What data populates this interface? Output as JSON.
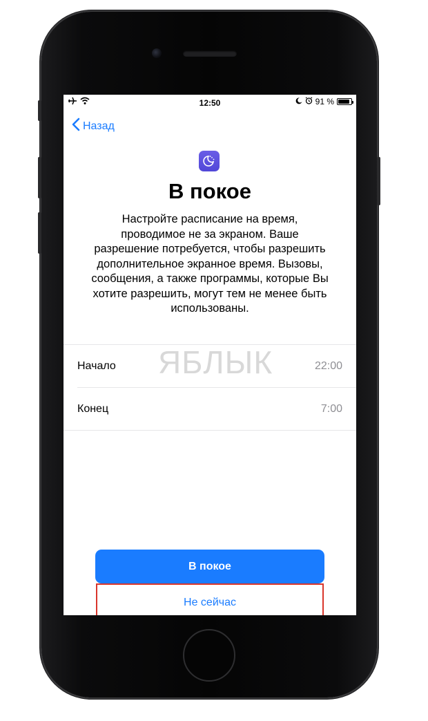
{
  "status_bar": {
    "time": "12:50",
    "battery": "91 %",
    "battery_level": 0.91,
    "icons_left": [
      "airplane-icon",
      "wifi-icon"
    ],
    "icons_right": [
      "moon-icon",
      "alarm-icon",
      "battery-icon"
    ]
  },
  "nav": {
    "back_label": "Назад"
  },
  "header": {
    "title": "В покое",
    "description": "Настройте расписание на время,\nпроводимое не за экраном. Ваше\nразрешение потребуется, чтобы разрешить\nдополнительное экранное время. Вызовы,\nсообщения, а также программы, которые Вы\nхотите разрешить, могут тем не менее быть\nиспользованы."
  },
  "schedule": {
    "rows": [
      {
        "label": "Начало",
        "value": "22:00"
      },
      {
        "label": "Конец",
        "value": "7:00"
      }
    ]
  },
  "actions": {
    "primary_label": "В покое",
    "secondary_label": "Не сейчас"
  },
  "watermark": "ЯБЛЫК",
  "colors": {
    "accent": "#1a7cff",
    "icon_bg": "#5a50de",
    "highlight": "#d9352b",
    "secondary_text": "#8e8e93"
  }
}
